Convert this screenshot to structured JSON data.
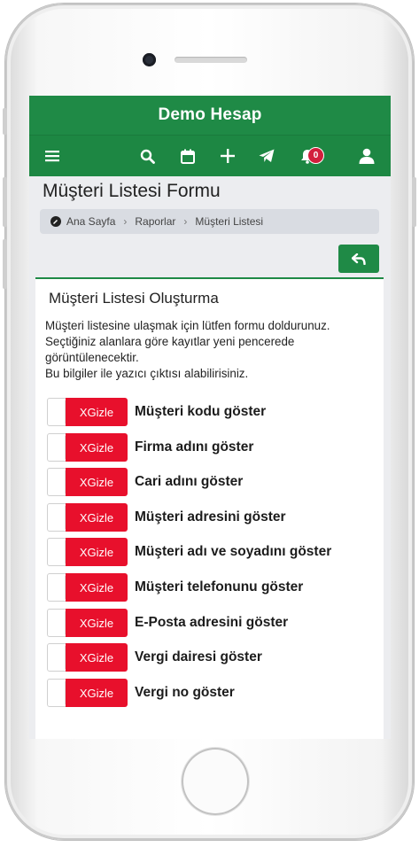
{
  "app": {
    "title": "Demo Hesap"
  },
  "toolbar": {
    "icons": [
      "menu-icon",
      "search-icon",
      "calendar-icon",
      "plus-icon",
      "send-icon",
      "bell-icon",
      "user-icon"
    ],
    "notification_count": "0"
  },
  "page": {
    "title": "Müşteri Listesi Formu"
  },
  "breadcrumb": {
    "items": [
      "Ana Sayfa",
      "Raporlar",
      "Müşteri Listesi"
    ]
  },
  "card": {
    "title": "Müşteri Listesi Oluşturma",
    "intro_lines": [
      "Müşteri listesine ulaşmak için lütfen formu doldurunuz.",
      "Seçtiğiniz alanlara göre kayıtlar yeni pencerede",
      "görüntülenecektir.",
      "Bu bilgiler ile yazıcı çıktısı alabilirisiniz."
    ],
    "toggle_label": "XGizle",
    "options": [
      "Müşteri kodu göster",
      "Firma adını göster",
      "Cari adını göster",
      "Müşteri adresini göster",
      "Müşteri adı ve soyadını göster",
      "Müşteri telefonunu göster",
      "E-Posta adresini göster",
      "Vergi dairesi göster",
      "Vergi no göster"
    ]
  },
  "colors": {
    "primary": "#1f8a46",
    "danger": "#e8102c",
    "badge": "#d21f3c"
  }
}
